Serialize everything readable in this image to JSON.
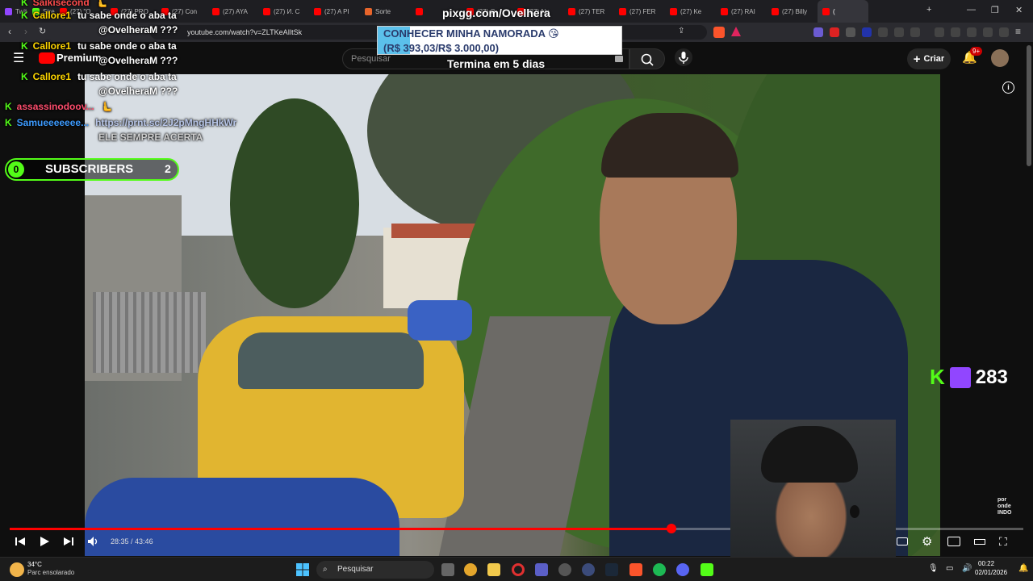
{
  "browser": {
    "tabs": [
      {
        "label": "Twitch",
        "color": "#9146ff"
      },
      {
        "label": "Stream",
        "color": "#53fc18"
      },
      {
        "label": "(27) \"O",
        "color": "#ff0000"
      },
      {
        "label": "(27) PRO",
        "color": "#ff0000"
      },
      {
        "label": "(27) Con",
        "color": "#ff0000"
      },
      {
        "label": "(27) AYA",
        "color": "#ff0000"
      },
      {
        "label": "(27) И. С",
        "color": "#ff0000"
      },
      {
        "label": "(27) A PI",
        "color": "#ff0000"
      },
      {
        "label": "Sorte",
        "color": "#e8652b"
      },
      {
        "label": "",
        "color": "#ff0000"
      },
      {
        "label": "(27) O",
        "color": "#ff0000"
      },
      {
        "label": "(27) Nu",
        "color": "#ff0000"
      },
      {
        "label": "(27) TER",
        "color": "#ff0000"
      },
      {
        "label": "(27) FER",
        "color": "#ff0000"
      },
      {
        "label": "(27) Ke",
        "color": "#ff0000"
      },
      {
        "label": "(27) RAI",
        "color": "#ff0000"
      },
      {
        "label": "(27) Billy",
        "color": "#ff0000"
      },
      {
        "label": "(",
        "color": "#ff0000"
      }
    ],
    "new_tab_label": "+",
    "url": "youtube.com/watch?v=ZLTKeAIltSk"
  },
  "youtube": {
    "logo_text": "Premium",
    "search_placeholder": "Pesquisar",
    "create_label": "Criar",
    "notif_badge": "9+"
  },
  "donation": {
    "url": "pixgg.com/Ovelhera",
    "goal_title": "CONHECER MINHA NAMORADA 😘",
    "goal_amount": "(R$ 393,03/R$ 3.000,00)",
    "goal_progress": 0.131,
    "ends": "Termina em 5 dias"
  },
  "chat": [
    {
      "user": "Saikisecond",
      "color": "#ff4d4d",
      "message": "🫷"
    },
    {
      "user": "Callore1",
      "color": "#ffd700",
      "message": "tu sabe onde o aba ta"
    },
    {
      "user": "",
      "color": "#ffffff",
      "message": "@OvelheraM ???"
    },
    {
      "user": "Callore1",
      "color": "#ffd700",
      "message": "tu sabe onde o aba ta"
    },
    {
      "user": "",
      "color": "#ffffff",
      "message": "@OvelheraM ???"
    },
    {
      "user": "Callore1",
      "color": "#ffd700",
      "message": "tu sabe onde o aba ta"
    },
    {
      "user": "",
      "color": "#ffffff",
      "message": "@OvelheraM ???"
    },
    {
      "user": "assassinodoov...",
      "color": "#ff4d6d",
      "message": "🫷"
    },
    {
      "user": "Samueeeeeee...",
      "color": "#3d9bff",
      "message": "https://prnt.sc/2J2pMngHHkWr"
    },
    {
      "user": "",
      "color": "#ffffff",
      "message": "ELE SEMPRE ACERTA"
    }
  ],
  "subscribers": {
    "left_count": "0",
    "label": "SUBSCRIBERS",
    "right_count": "2"
  },
  "viewers": {
    "count": "283"
  },
  "video": {
    "time_current": "28:35",
    "time_total": "43:46",
    "progress": 0.653,
    "watermark": "por onde INDO"
  },
  "taskbar": {
    "weather_temp": "34°C",
    "weather_desc": "Parc ensolarado",
    "search_label": "Pesquisar",
    "time": "00:22",
    "date": "02/01/2026"
  }
}
